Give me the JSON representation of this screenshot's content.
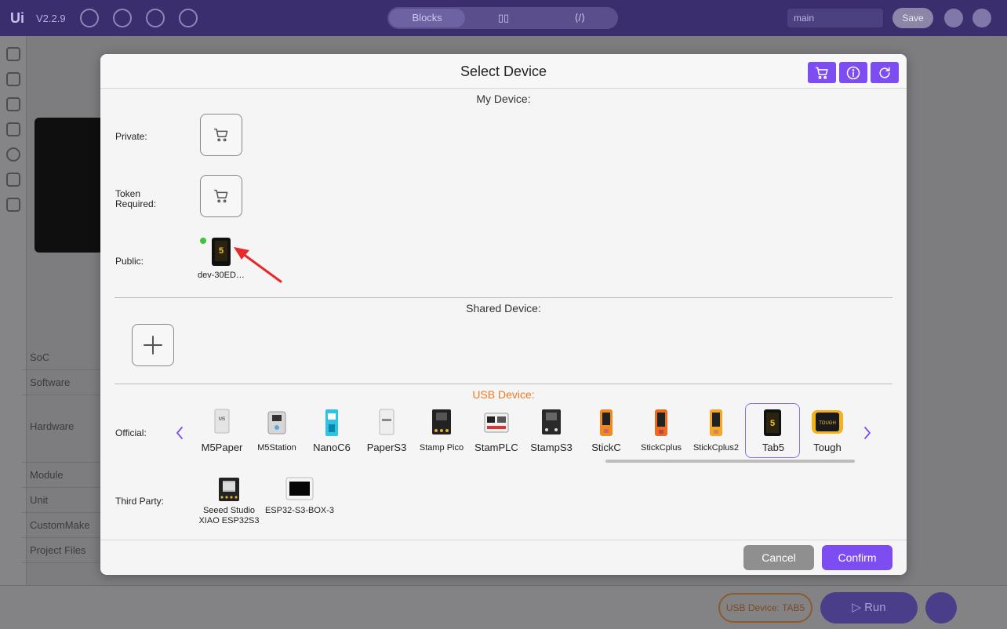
{
  "app": {
    "version": "V2.2.9",
    "tabs": [
      "Blocks",
      "",
      ""
    ],
    "project_name": "main",
    "save_label": "Save",
    "props": [
      "SoC",
      "Software",
      "Hardware",
      "Module",
      "Unit",
      "CustomMake",
      "Project Files"
    ],
    "usb_status": "USB Device: TAB5",
    "run_label": "Run"
  },
  "modal": {
    "title": "Select Device",
    "header_buttons": [
      {
        "icon": "cart-icon"
      },
      {
        "icon": "info-icon"
      },
      {
        "icon": "refresh-icon"
      }
    ],
    "my_device": {
      "title": "My Device:",
      "private_label": "Private:",
      "token_label": "Token Required:",
      "public_label": "Public:",
      "public_devices": [
        {
          "name": "dev-30ED…",
          "status": "online",
          "screen_text": "5"
        }
      ]
    },
    "shared_device": {
      "title": "Shared Device:"
    },
    "usb_device": {
      "title": "USB Device:",
      "official_label": "Official:",
      "selected": "Tab5",
      "devices": [
        {
          "name": "M5Paper",
          "size": "normal",
          "icon": "m5paper-icon"
        },
        {
          "name": "M5Station",
          "size": "small",
          "icon": "m5station-icon"
        },
        {
          "name": "NanoC6",
          "size": "normal",
          "icon": "nanoc6-icon"
        },
        {
          "name": "PaperS3",
          "size": "normal",
          "icon": "papers3-icon"
        },
        {
          "name": "Stamp Pico",
          "size": "small",
          "icon": "stamp-pico-icon"
        },
        {
          "name": "StamPLC",
          "size": "normal",
          "icon": "stamplc-icon"
        },
        {
          "name": "StampS3",
          "size": "normal",
          "icon": "stamps3-icon"
        },
        {
          "name": "StickC",
          "size": "normal",
          "icon": "stickc-icon"
        },
        {
          "name": "StickCplus",
          "size": "small",
          "icon": "stickcplus-icon"
        },
        {
          "name": "StickCplus2",
          "size": "small",
          "icon": "stickcplus2-icon"
        },
        {
          "name": "Tab5",
          "size": "normal",
          "icon": "tab5-icon"
        },
        {
          "name": "Tough",
          "size": "normal",
          "icon": "tough-icon"
        }
      ],
      "third_party_label": "Third Party:",
      "third_party": [
        {
          "name": "Seeed Studio XIAO ESP32S3",
          "icon": "xiao-esp32s3-icon"
        },
        {
          "name": "ESP32-S3-BOX-3",
          "icon": "esp32-s3-box-3-icon"
        }
      ]
    },
    "cancel_label": "Cancel",
    "confirm_label": "Confirm",
    "colors": {
      "accent": "#7d4df2",
      "usb_title": "#ee7b22",
      "online": "#3fc43a",
      "cancel": "#8f8f8f"
    }
  }
}
